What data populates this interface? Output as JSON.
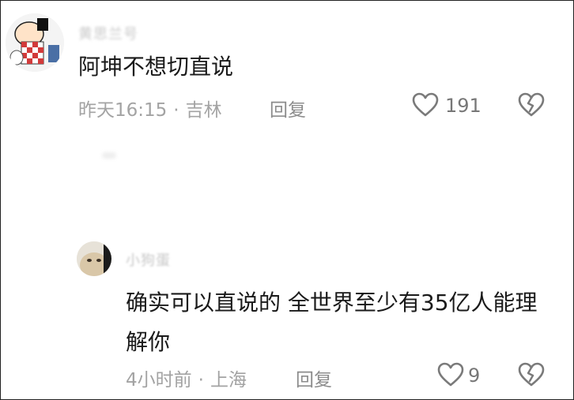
{
  "comments": [
    {
      "username": "黄思兰号",
      "text": "阿坤不想切直说",
      "time": "昨天16:15",
      "separator": "·",
      "location": "吉林",
      "reply_label": "回复",
      "likes": "191",
      "avatar_icon": "cartoon-avatar",
      "like_icon": "heart-outline-icon",
      "dislike_icon": "broken-heart-icon"
    },
    {
      "username": "小狗蛋",
      "text": "确实可以直说的 全世界至少有35亿人能理解你",
      "time": "4小时前",
      "separator": "·",
      "location": "上海",
      "reply_label": "回复",
      "likes": "9",
      "avatar_icon": "photo-avatar",
      "like_icon": "heart-outline-icon",
      "dislike_icon": "broken-heart-icon"
    }
  ],
  "colors": {
    "text": "#1a1a1a",
    "meta": "#a3a3a3",
    "icon": "#7a7a7a"
  }
}
